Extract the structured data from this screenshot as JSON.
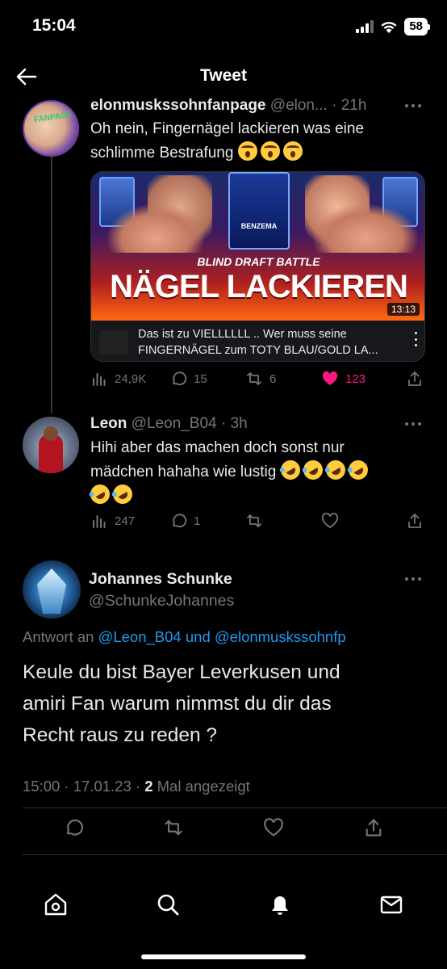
{
  "status_bar": {
    "time": "15:04",
    "battery": "58"
  },
  "header": {
    "title": "Tweet"
  },
  "tweets": [
    {
      "name": "elonmuskssohnfanpage",
      "handle": "@elon...",
      "time": "· 21h",
      "avatar_label": "FANPAGE",
      "text_line1": "Oh nein, Fingernägel lackieren was eine",
      "text_line2": "schlimme Bestrafung",
      "video": {
        "overlay_small": "BLIND DRAFT BATTLE",
        "overlay_big": "NÄGEL LACKIEREN",
        "player_name": "BENZEMA",
        "duration": "13:13",
        "caption_line1": "Das ist zu VIELLLLLL ..  Wer muss seine",
        "caption_line2": "FINGERNÄGEL zum TOTY BLAU/GOLD LA..."
      },
      "stats": {
        "views": "24,9K",
        "replies": "15",
        "retweets": "6",
        "likes": "123"
      }
    },
    {
      "name": "Leon",
      "handle": "@Leon_B04",
      "time": "· 3h",
      "text_line1": "Hihi aber das machen doch sonst nur",
      "text_line2": "mädchen hahaha wie lustig",
      "stats": {
        "views": "247",
        "replies": "1"
      }
    }
  ],
  "main_tweet": {
    "name": "Johannes Schunke",
    "handle": "@SchunkeJohannes",
    "reply_prefix": "Antwort an",
    "mention1": "@Leon_B04",
    "reply_and": "und",
    "mention2": "@elonmuskssohnfp",
    "text_line1": "Keule du bist Bayer Leverkusen und",
    "text_line2": "amiri Fan warum nimmst du dir das",
    "text_line3": "Recht raus zu reden ?",
    "timestamp": "15:00 · 17.01.23 ·",
    "view_count": "2",
    "view_label": "Mal angezeigt"
  },
  "colors": {
    "background": "#000000",
    "accent": "#1d9bf0",
    "like": "#f91880",
    "muted": "#71767b"
  },
  "icons": [
    "back-arrow-icon",
    "more-icon",
    "views-icon",
    "reply-icon",
    "retweet-icon",
    "like-icon",
    "share-icon",
    "home-icon",
    "search-icon",
    "notifications-icon",
    "messages-icon"
  ]
}
